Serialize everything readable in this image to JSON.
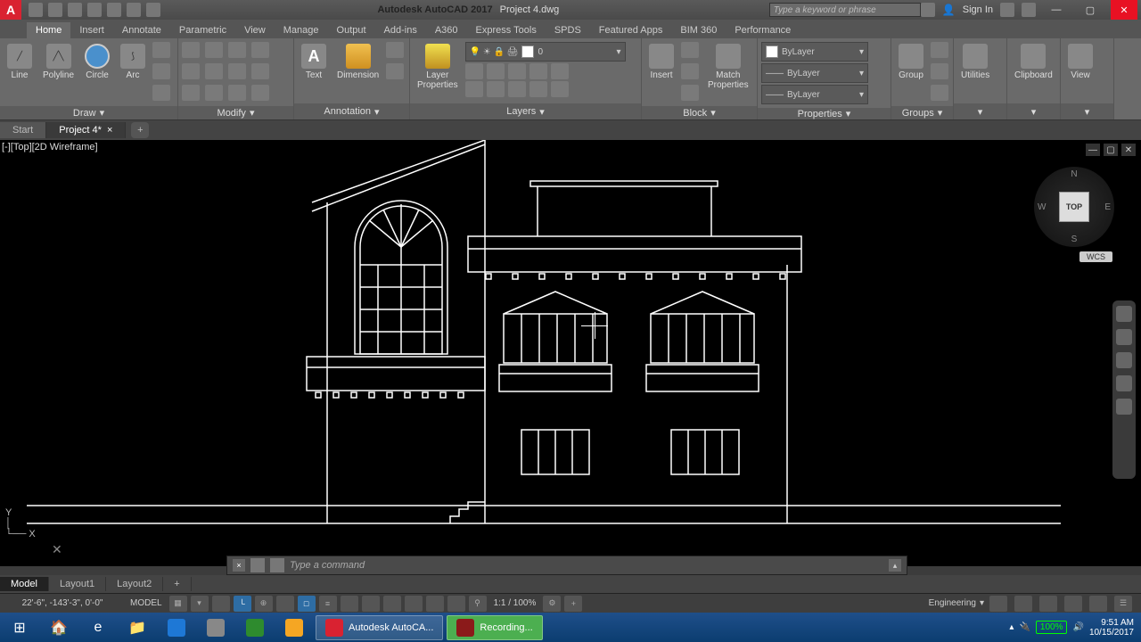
{
  "title": {
    "app": "Autodesk AutoCAD 2017",
    "doc": "Project 4.dwg"
  },
  "search_placeholder": "Type a keyword or phrase",
  "sign_in": "Sign In",
  "ribbon_tabs": [
    "Home",
    "Insert",
    "Annotate",
    "Parametric",
    "View",
    "Manage",
    "Output",
    "Add-ins",
    "A360",
    "Express Tools",
    "SPDS",
    "Featured Apps",
    "BIM 360",
    "Performance"
  ],
  "active_tab": "Home",
  "panels": {
    "draw": {
      "title": "Draw",
      "buttons": [
        "Line",
        "Polyline",
        "Circle",
        "Arc"
      ]
    },
    "modify": {
      "title": "Modify"
    },
    "annotation": {
      "title": "Annotation",
      "buttons": [
        "Text",
        "Dimension"
      ]
    },
    "layers": {
      "title": "Layers",
      "layer_properties": "Layer\nProperties",
      "current": "0"
    },
    "block": {
      "title": "Block",
      "insert": "Insert",
      "match": "Match\nProperties"
    },
    "properties": {
      "title": "Properties",
      "bylayer": "ByLayer"
    },
    "groups": {
      "title": "Groups",
      "group": "Group"
    },
    "utilities": {
      "title": "Utilities"
    },
    "clipboard": {
      "title": "Clipboard"
    },
    "view": {
      "title": "View"
    }
  },
  "doc_tabs": {
    "start": "Start",
    "active": "Project 4*"
  },
  "viewport": {
    "label": "[-][Top][2D Wireframe]",
    "cube": {
      "top": "TOP",
      "n": "N",
      "s": "S",
      "e": "E",
      "w": "W"
    },
    "wcs": "WCS"
  },
  "command": {
    "placeholder": "Type a command"
  },
  "layout_tabs": [
    "Model",
    "Layout1",
    "Layout2"
  ],
  "status": {
    "coords": "22'-6\", -143'-3\", 0'-0\"",
    "model": "MODEL",
    "scale": "1:1 / 100%",
    "units": "Engineering"
  },
  "taskbar": {
    "apps": {
      "acad": "Autodesk AutoCA...",
      "rec": "Recording..."
    },
    "battery": "100%",
    "time": "9:51 AM",
    "date": "10/15/2017"
  }
}
